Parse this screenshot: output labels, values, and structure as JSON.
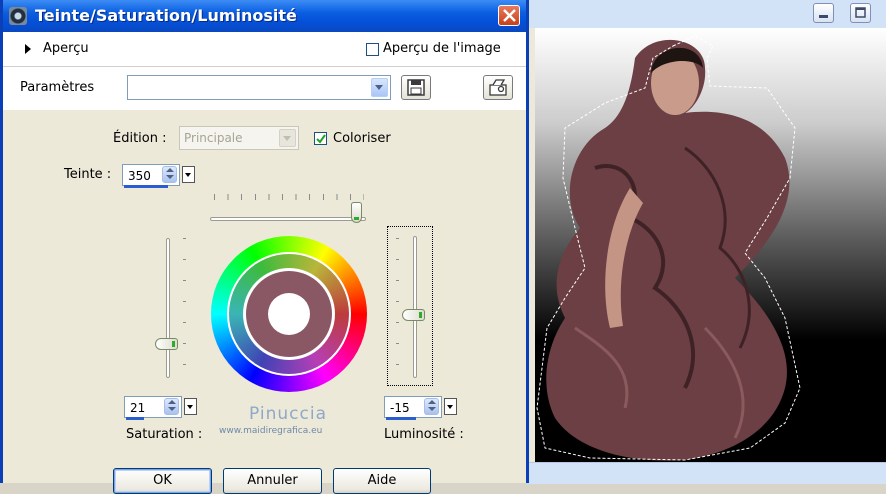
{
  "dialog": {
    "title": "Teinte/Saturation/Luminosité",
    "apercu_label": "Aperçu",
    "apercu_image_label": "Aperçu de l'image",
    "parametres_label": "Paramètres",
    "parametres_value": "",
    "edition_label": "Édition :",
    "edition_value": "Principale",
    "coloriser_label": "Coloriser",
    "coloriser_checked": true,
    "teinte_label": "Teinte :",
    "teinte_value": "350",
    "teinte_max": 359,
    "saturation_label": "Saturation :",
    "saturation_value": "21",
    "luminosite_label": "Luminosité :",
    "luminosite_value": "-15",
    "watermark_name": "Pinuccia",
    "watermark_url": "www.maidiregrafica.eu",
    "buttons": {
      "ok": "OK",
      "cancel": "Annuler",
      "help": "Aide"
    },
    "colors": {
      "title_bar": "#0a5ee0",
      "selection_dashed": "#ffffff",
      "tint_swatch": "#8a5865"
    }
  },
  "icons": {
    "close": "close-icon",
    "save": "floppy-disk-icon",
    "tool": "tool-icon",
    "app": "app-icon"
  },
  "canvas": {
    "min_button": "minimize-icon",
    "max_button": "maximize-icon"
  }
}
